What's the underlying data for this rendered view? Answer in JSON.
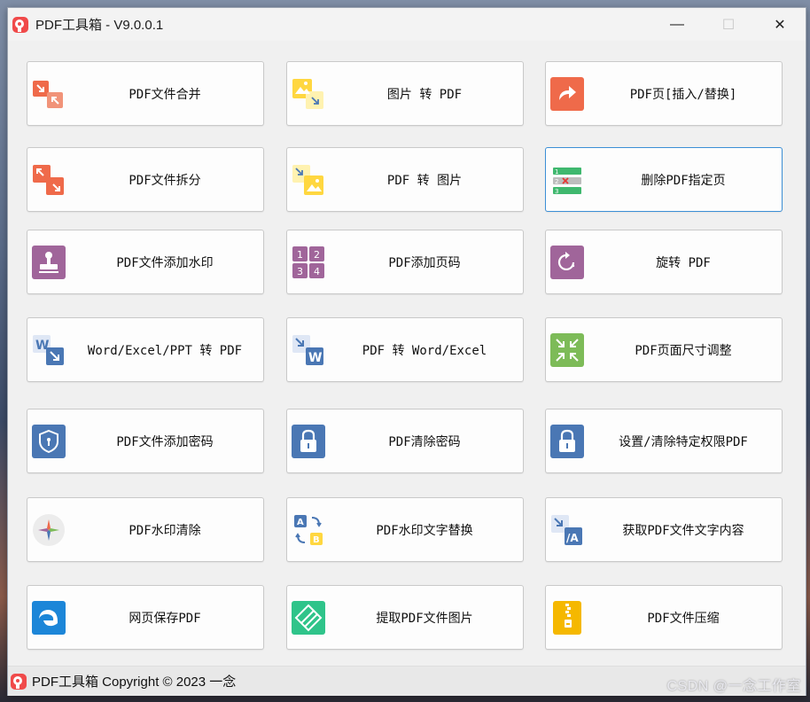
{
  "window": {
    "title": "PDF工具箱 - V9.0.0.1",
    "controls": {
      "minimize": "—",
      "maximize": "☐",
      "close": "✕"
    }
  },
  "tools": [
    {
      "label": "PDF文件合并",
      "icon": "merge-icon"
    },
    {
      "label": "图片 转 PDF",
      "icon": "image-to-pdf-icon"
    },
    {
      "label": "PDF页[插入/替换]",
      "icon": "insert-replace-icon"
    },
    {
      "label": "PDF文件拆分",
      "icon": "split-icon"
    },
    {
      "label": "PDF 转 图片",
      "icon": "pdf-to-image-icon"
    },
    {
      "label": "删除PDF指定页",
      "icon": "delete-pages-icon"
    },
    {
      "label": "PDF文件添加水印",
      "icon": "stamp-icon"
    },
    {
      "label": "PDF添加页码",
      "icon": "page-numbers-icon"
    },
    {
      "label": "旋转 PDF",
      "icon": "rotate-icon"
    },
    {
      "label": "Word/Excel/PPT 转 PDF",
      "icon": "word-to-pdf-icon"
    },
    {
      "label": "PDF 转 Word/Excel",
      "icon": "pdf-to-word-icon"
    },
    {
      "label": "PDF页面尺寸调整",
      "icon": "resize-icon"
    },
    {
      "label": "PDF文件添加密码",
      "icon": "shield-icon"
    },
    {
      "label": "PDF清除密码",
      "icon": "unlock-icon"
    },
    {
      "label": "设置/清除特定权限PDF",
      "icon": "lock-icon"
    },
    {
      "label": "PDF水印清除",
      "icon": "watermark-remove-icon"
    },
    {
      "label": "PDF水印文字替换",
      "icon": "text-replace-icon"
    },
    {
      "label": "获取PDF文件文字内容",
      "icon": "extract-text-icon"
    },
    {
      "label": "网页保存PDF",
      "icon": "edge-browser-icon"
    },
    {
      "label": "提取PDF文件图片",
      "icon": "extract-images-icon"
    },
    {
      "label": "PDF文件压缩",
      "icon": "zip-icon"
    }
  ],
  "active_tool": "删除PDF指定页",
  "footer": {
    "text": "PDF工具箱 Copyright © 2023 一念"
  },
  "watermark": "CSDN @一念工作室",
  "colors": {
    "accent": "#3c8fd6",
    "merge": "#ef6a4a",
    "image": "#ffd740",
    "stamp": "#a0659a",
    "blue": "#4a77b4",
    "green": "#7dbb58",
    "zip": "#f5b800"
  }
}
